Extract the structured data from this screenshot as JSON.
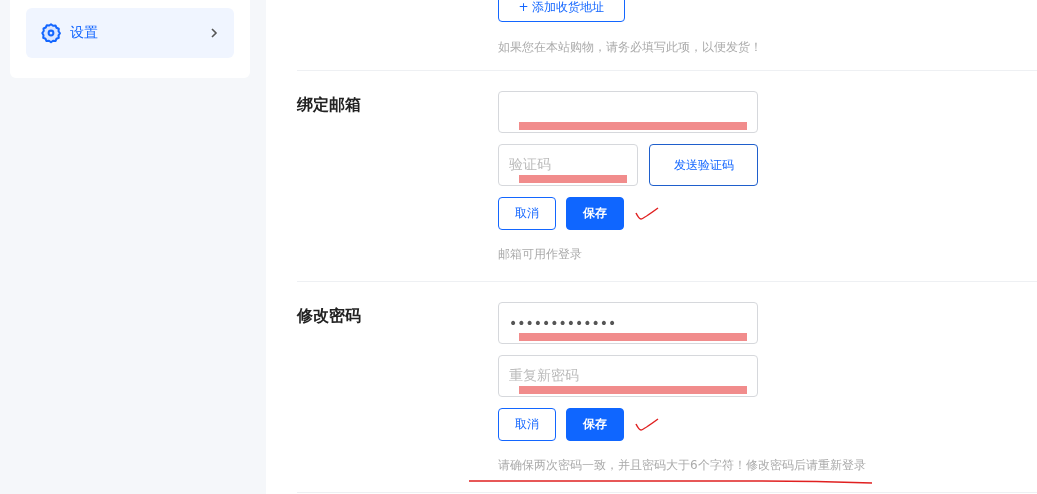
{
  "sidebar": {
    "items": [
      {
        "label": "设置",
        "selected": true
      }
    ]
  },
  "address_section": {
    "add_button": "+ 添加收货地址",
    "hint": "如果您在本站购物，请务必填写此项，以便发货！"
  },
  "sections": [
    {
      "title": "绑定邮箱",
      "fields": [
        {
          "kind": "text",
          "redacted": true
        },
        {
          "kind": "code",
          "placeholder": "验证码",
          "redacted": true,
          "send_button": "发送验证码"
        }
      ],
      "cancel": "取消",
      "save": "保存",
      "checkmark": true,
      "hint": "邮箱可用作登录"
    },
    {
      "title": "修改密码",
      "fields": [
        {
          "kind": "password",
          "value": "•••••••••••••",
          "redacted": true
        },
        {
          "kind": "text",
          "placeholder": "重复新密码",
          "redacted": true
        }
      ],
      "cancel": "取消",
      "save": "保存",
      "checkmark": true,
      "hint": "请确保两次密码一致，并且密码大于6个字符！修改密码后请重新登录",
      "underlined": true
    }
  ]
}
